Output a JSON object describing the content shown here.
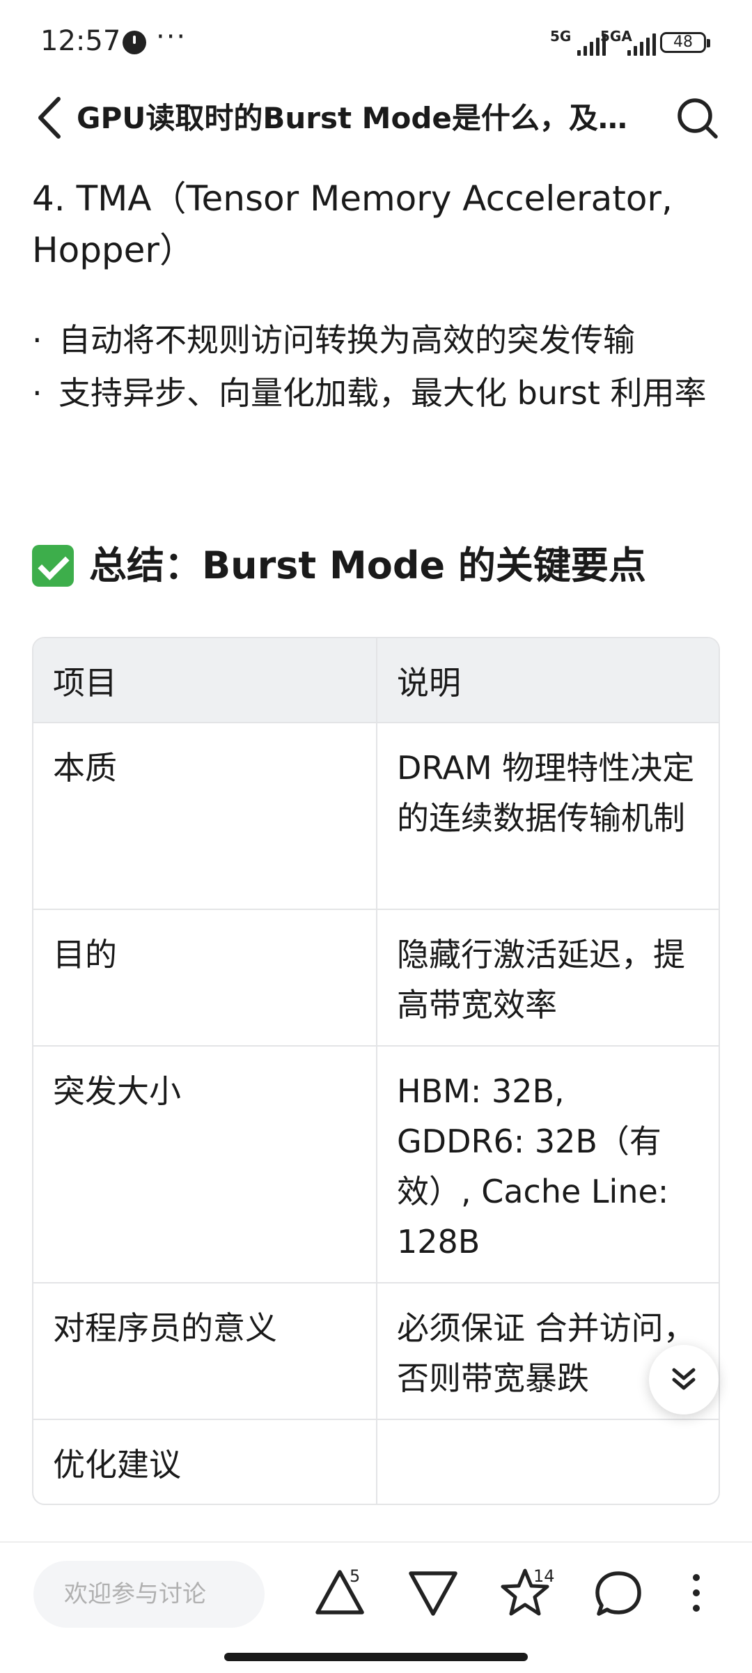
{
  "status": {
    "time": "12:57",
    "more": "···",
    "net1": "5G",
    "net2": "5GA",
    "battery": "48"
  },
  "header": {
    "title": "GPU读取时的Burst Mode是什么，及其..."
  },
  "section4": {
    "heading": "4. TMA（Tensor Memory Accelerator, Hopper）",
    "bullets": [
      "自动将不规则访问转换为高效的突发传输",
      "支持异步、向量化加载，最大化 burst 利用率"
    ]
  },
  "summary": {
    "title": "总结：Burst Mode 的关键要点"
  },
  "table": {
    "headers": [
      "项目",
      "说明"
    ],
    "rows": [
      {
        "item": "本质",
        "desc": "DRAM 物理特性决定的连续数据传输机制"
      },
      {
        "item": "目的",
        "desc": "隐藏行激活延迟，提高带宽效率"
      },
      {
        "item": "突发大小",
        "desc": "HBM: 32B, GDDR6: 32B（有效）, Cache Line: 128B"
      },
      {
        "item": "对程序员的意义",
        "desc": "必须保证 合并访问，否则带宽暴跌"
      },
      {
        "item": "优化建议",
        "desc": ""
      }
    ]
  },
  "bottom": {
    "input_placeholder": "欢迎参与讨论",
    "upvote_count": "5",
    "star_count": "14"
  },
  "colors": {
    "accent_check": "#3dae4b",
    "table_head_bg": "#eef0f2",
    "border": "#e3e4e6"
  }
}
